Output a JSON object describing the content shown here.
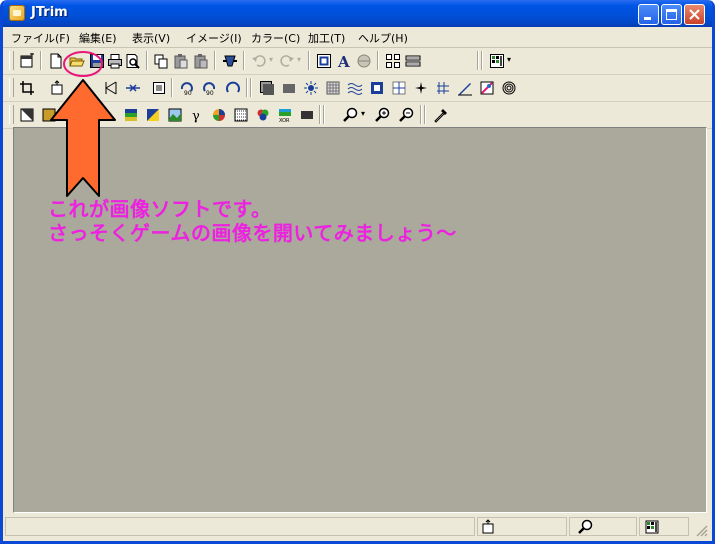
{
  "window": {
    "title": "JTrim"
  },
  "menu": {
    "items": [
      "ファイル(F)",
      "編集(E)",
      "表示(V)",
      "イメージ(I)",
      "カラー(C)",
      "加工(T)",
      "ヘルプ(H)"
    ]
  },
  "annotation": {
    "line1": "これが画像ソフトです。",
    "line2": "さっそくゲームの画像を開いてみましょう～"
  },
  "colors": {
    "annotation_text": "#ed21e0",
    "arrow_fill": "#ff6b2e",
    "highlight_ring": "#e8187a",
    "canvas_bg": "#aba89c",
    "titlebar": "#0054e3"
  },
  "icons": {
    "toolbar1": [
      "new-window-icon",
      "new-file-icon",
      "open-folder-icon",
      "save-icon",
      "print-icon",
      "print-preview-icon",
      "copy-icon",
      "paste-icon",
      "paste-new-icon",
      "capture-icon",
      "undo-icon",
      "redo-icon",
      "fit-window-icon",
      "text-icon",
      "fill-icon",
      "grid-view-icon",
      "thumbnail-icon",
      "palette-icon"
    ],
    "toolbar2": [
      "crop-icon",
      "resize-icon",
      "flip-horizontal-icon",
      "flip-vertical-icon",
      "rotate-90-icon",
      "rotate-free-icon",
      "frame-icon",
      "shadow-icon",
      "light-icon",
      "mosaic-icon",
      "wave-icon",
      "emboss-icon",
      "tile-icon",
      "sparkle-icon",
      "blur-icon",
      "pen-icon",
      "clip-icon",
      "swirl-icon"
    ],
    "toolbar3": [
      "gray-icon",
      "contrast-icon",
      "color-balance-icon",
      "gradient-icon",
      "image-icon",
      "gamma-icon",
      "color-wheel-icon",
      "dither-icon",
      "rgb-icon",
      "xor-icon",
      "bar-icon",
      "zoom-icon",
      "zoom-in-icon",
      "zoom-out-icon",
      "eyedropper-icon"
    ],
    "status": [
      "resize-status-icon",
      "zoom-status-icon",
      "palette-status-icon"
    ]
  }
}
